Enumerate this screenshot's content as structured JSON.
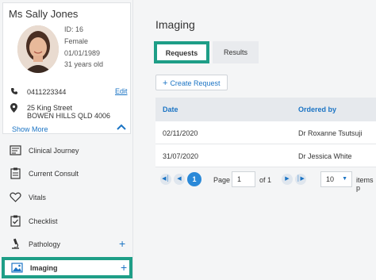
{
  "patient": {
    "name": "Ms Sally Jones",
    "id": "ID: 16",
    "gender": "Female",
    "dob": "01/01/1989",
    "age": "31 years old",
    "phone": "0411223344",
    "edit_label": "Edit",
    "address_line1": "25 King Street",
    "address_line2": "BOWEN HILLS QLD 4006",
    "show_more_label": "Show More"
  },
  "sidebar": {
    "items": [
      {
        "label": "Clinical Journey",
        "icon": "journey-icon"
      },
      {
        "label": "Current Consult",
        "icon": "consult-icon"
      },
      {
        "label": "Vitals",
        "icon": "heart-icon"
      },
      {
        "label": "Checklist",
        "icon": "checklist-icon"
      },
      {
        "label": "Pathology",
        "icon": "microscope-icon",
        "plus": "+"
      },
      {
        "label": "Imaging",
        "icon": "image-icon",
        "plus": "+"
      }
    ]
  },
  "main": {
    "title": "Imaging",
    "tabs": [
      {
        "label": "Requests",
        "active": true
      },
      {
        "label": "Results",
        "active": false
      }
    ],
    "create_button": "Create Request",
    "table": {
      "headers": [
        "Date",
        "Ordered by"
      ],
      "rows": [
        [
          "02/11/2020",
          "Dr Roxanne Tsutsuji"
        ],
        [
          "31/07/2020",
          "Dr Jessica White"
        ]
      ]
    },
    "pager": {
      "current_page": "1",
      "page_label": "Page",
      "page_input": "1",
      "of_label": "of 1",
      "page_size": "10",
      "items_label": "items p"
    }
  },
  "colors": {
    "accent": "#1b74c4",
    "highlight_border": "#1e9e87",
    "header_bg": "#e6e9ed"
  }
}
